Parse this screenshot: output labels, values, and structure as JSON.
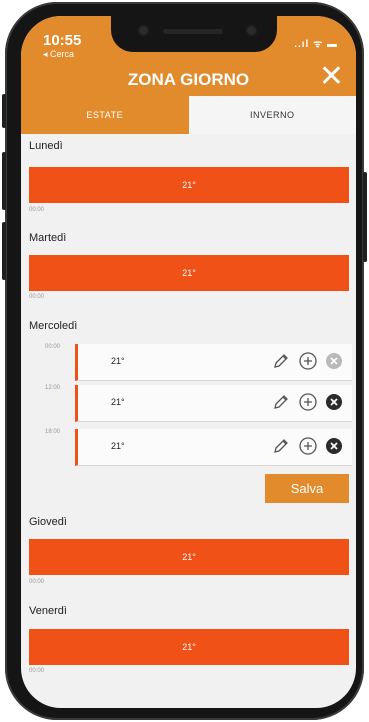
{
  "status_bar": {
    "time": "10:55",
    "back_label": "◂ Cerca",
    "indicators": "..ıl ᯤ ▬"
  },
  "header": {
    "title": "ZONA GIORNO",
    "close_icon": "close-icon"
  },
  "tabs": [
    {
      "label": "ESTATE",
      "active": false
    },
    {
      "label": "INVERNO",
      "active": true
    }
  ],
  "days": [
    {
      "name": "Lunedì",
      "temp": "21°",
      "time": "00:00"
    },
    {
      "name": "Martedì",
      "temp": "21°",
      "time": "00:00"
    },
    {
      "name": "Mercoledì",
      "slots": [
        {
          "time": "00:00",
          "temp": "21°"
        },
        {
          "time": "12:00",
          "temp": "21°"
        },
        {
          "time": "18:00",
          "temp": "21°"
        }
      ]
    },
    {
      "name": "Giovedì",
      "temp": "21°",
      "time": "00:00"
    },
    {
      "name": "Venerdì",
      "temp": "21°",
      "time": "00:00"
    }
  ],
  "actions": {
    "save_label": "Salva"
  },
  "colors": {
    "accent": "#e28b2c",
    "bar": "#ef5117",
    "background": "#f1f1f1"
  }
}
